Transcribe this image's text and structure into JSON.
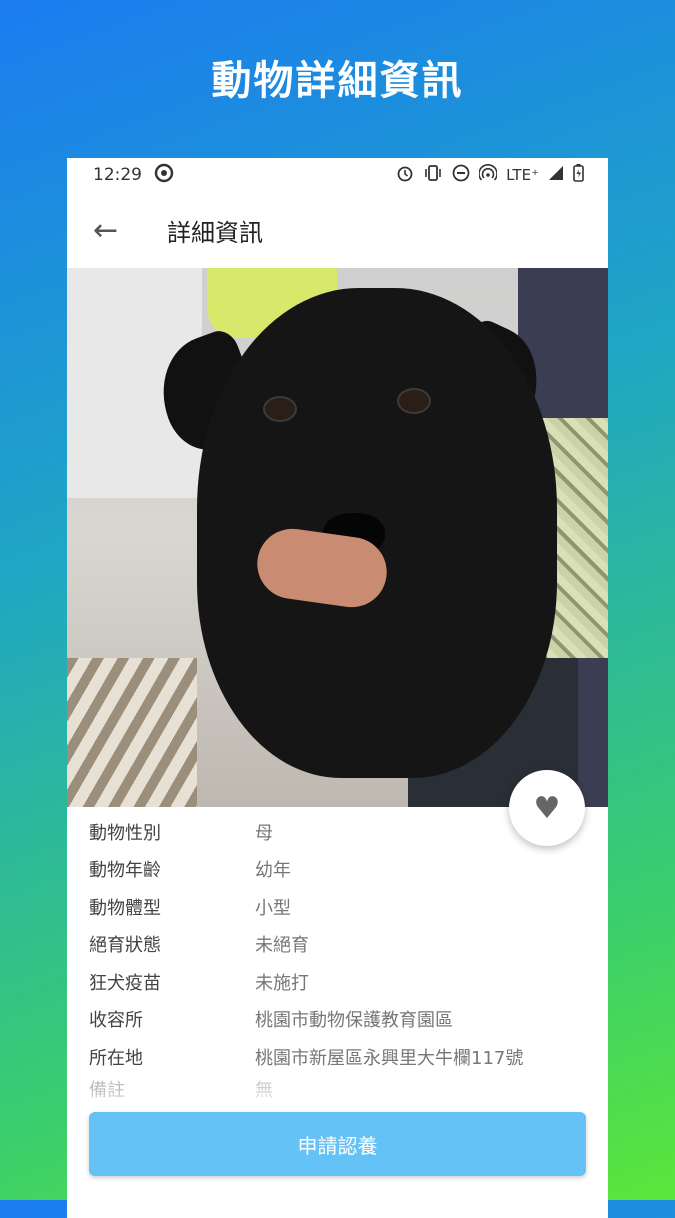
{
  "promo": {
    "title": "動物詳細資訊"
  },
  "status_bar": {
    "time": "12:29",
    "network": "LTE⁺"
  },
  "app_bar": {
    "back": "←",
    "title": "詳細資訊"
  },
  "details": [
    {
      "label": "動物性別",
      "value": "母"
    },
    {
      "label": "動物年齡",
      "value": "幼年"
    },
    {
      "label": "動物體型",
      "value": "小型"
    },
    {
      "label": "絕育狀態",
      "value": "未絕育"
    },
    {
      "label": "狂犬疫苗",
      "value": "未施打"
    },
    {
      "label": "收容所",
      "value": "桃園市動物保護教育園區"
    },
    {
      "label": "所在地",
      "value": "桃園市新屋區永興里大牛欄117號"
    },
    {
      "label": "備註",
      "value": "無"
    }
  ],
  "favorite_icon": "♥",
  "adopt_button": {
    "label": "申請認養"
  },
  "colors": {
    "button": "#64c2f7",
    "gradient_top": "#1b7cf0",
    "gradient_bottom": "#5ce63a"
  }
}
